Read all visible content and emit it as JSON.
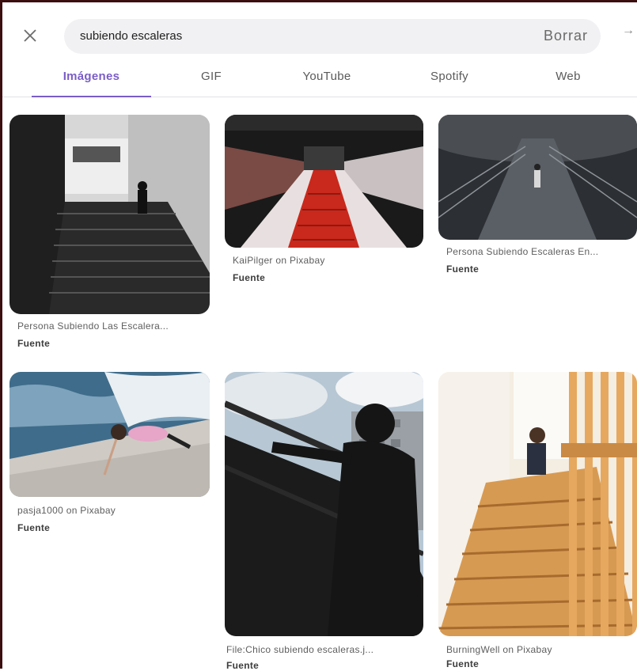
{
  "search": {
    "query": "subiendo escaleras",
    "clear_label": "Borrar",
    "arrow_icon": "arrow-right-icon",
    "close_icon": "close-icon"
  },
  "tabs": [
    {
      "label": "Imágenes",
      "active": true
    },
    {
      "label": "GIF",
      "active": false
    },
    {
      "label": "YouTube",
      "active": false
    },
    {
      "label": "Spotify",
      "active": false
    },
    {
      "label": "Web",
      "active": false
    }
  ],
  "accent_color": "#7a5dc7",
  "results": [
    {
      "caption": "Persona Subiendo Las Escalera...",
      "source_label": "Fuente"
    },
    {
      "caption": "KaiPilger on Pixabay",
      "source_label": "Fuente"
    },
    {
      "caption": "Persona Subiendo Escaleras En...",
      "source_label": "Fuente"
    },
    {
      "caption": "pasja1000 on Pixabay",
      "source_label": "Fuente"
    },
    {
      "caption": "File:Chico subiendo escaleras.j...",
      "source_label": "Fuente"
    },
    {
      "caption": "BurningWell on Pixabay",
      "source_label": "Fuente"
    }
  ]
}
